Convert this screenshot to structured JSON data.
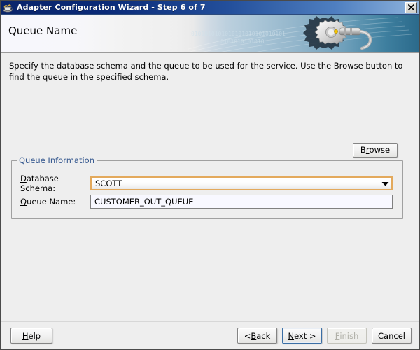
{
  "window": {
    "title": "Adapter Configuration Wizard - Step 6 of 7",
    "icon": "coffee-cup-icon",
    "close_label": "Close"
  },
  "banner": {
    "heading": "Queue Name",
    "art": "gear-and-binary-graphic"
  },
  "instructions": "Specify the database schema and the queue to be used for the service. Use the Browse button to find the queue in the specified schema.",
  "browse_button": {
    "label": "Browse",
    "mnemonic": "r"
  },
  "group": {
    "legend": "Queue Information",
    "fields": [
      {
        "label": "Database Schema:",
        "mnemonic": "D",
        "type": "combobox",
        "value": "SCOTT",
        "focused": true
      },
      {
        "label": "Queue Name:",
        "mnemonic": "Q",
        "type": "textfield",
        "value": "CUSTOMER_OUT_QUEUE",
        "focused": false
      }
    ]
  },
  "footer": {
    "help": {
      "label": "Help",
      "mnemonic": "H",
      "enabled": true
    },
    "back": {
      "label": "< Back",
      "mnemonic": "B",
      "enabled": true
    },
    "next": {
      "label": "Next >",
      "mnemonic": "N",
      "enabled": true,
      "focused": true
    },
    "finish": {
      "label": "Finish",
      "mnemonic": "F",
      "enabled": false
    },
    "cancel": {
      "label": "Cancel",
      "mnemonic": "",
      "enabled": true
    }
  },
  "colors": {
    "titlebar_start": "#0a246a",
    "titlebar_end": "#8fb4dd",
    "content_bg": "#eeeeee",
    "legend_text": "#35588f",
    "focus_border": "#e3a95c",
    "button_focus": "#3a6ea5",
    "field_bg": "#f8f8ff"
  }
}
